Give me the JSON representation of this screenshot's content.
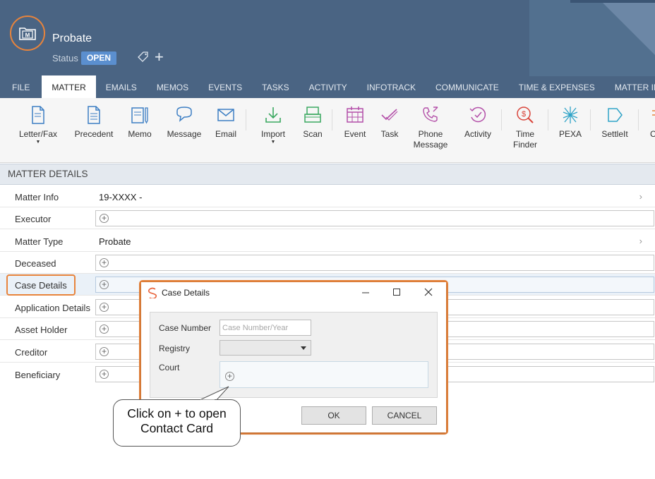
{
  "app": {
    "matter_title": "Probate",
    "status_label": "Status",
    "status_value": "OPEN"
  },
  "tabs": [
    {
      "label": "FILE"
    },
    {
      "label": "MATTER"
    },
    {
      "label": "EMAILS"
    },
    {
      "label": "MEMOS"
    },
    {
      "label": "EVENTS"
    },
    {
      "label": "TASKS"
    },
    {
      "label": "ACTIVITY"
    },
    {
      "label": "INFOTRACK"
    },
    {
      "label": "COMMUNICATE"
    },
    {
      "label": "TIME & EXPENSES"
    },
    {
      "label": "MATTER INSIGHTS"
    }
  ],
  "ribbon": {
    "letter_fax": "Letter/Fax",
    "precedent": "Precedent",
    "memo": "Memo",
    "message": "Message",
    "email": "Email",
    "import": "Import",
    "scan": "Scan",
    "event": "Event",
    "task": "Task",
    "phone_message_1": "Phone",
    "phone_message_2": "Message",
    "activity": "Activity",
    "time_finder_1": "Time",
    "time_finder_2": "Finder",
    "pexa": "PEXA",
    "settleit": "SettleIt",
    "cut": "C"
  },
  "section": {
    "title": "MATTER DETAILS"
  },
  "rows": [
    {
      "label": "Matter Info",
      "value": "19-XXXX -"
    },
    {
      "label": "Executor"
    },
    {
      "label": "Matter Type",
      "value": "Probate"
    },
    {
      "label": "Deceased"
    },
    {
      "label": "Case Details"
    },
    {
      "label": "Application Details"
    },
    {
      "label": "Asset Holder"
    },
    {
      "label": "Creditor"
    },
    {
      "label": "Beneficiary"
    }
  ],
  "dialog": {
    "title": "Case Details",
    "case_number_label": "Case Number",
    "case_number_placeholder": "Case Number/Year",
    "case_number_value": "",
    "registry_label": "Registry",
    "registry_value": "",
    "court_label": "Court",
    "ok": "OK",
    "cancel": "CANCEL"
  },
  "callout": {
    "line1": "Click on + to open",
    "line2": "Contact Card"
  },
  "colors": {
    "header": "#4a6483",
    "accent": "#e8843c",
    "status_badge": "#5b8fcf",
    "ribbon_bg": "#f6f6f6"
  }
}
